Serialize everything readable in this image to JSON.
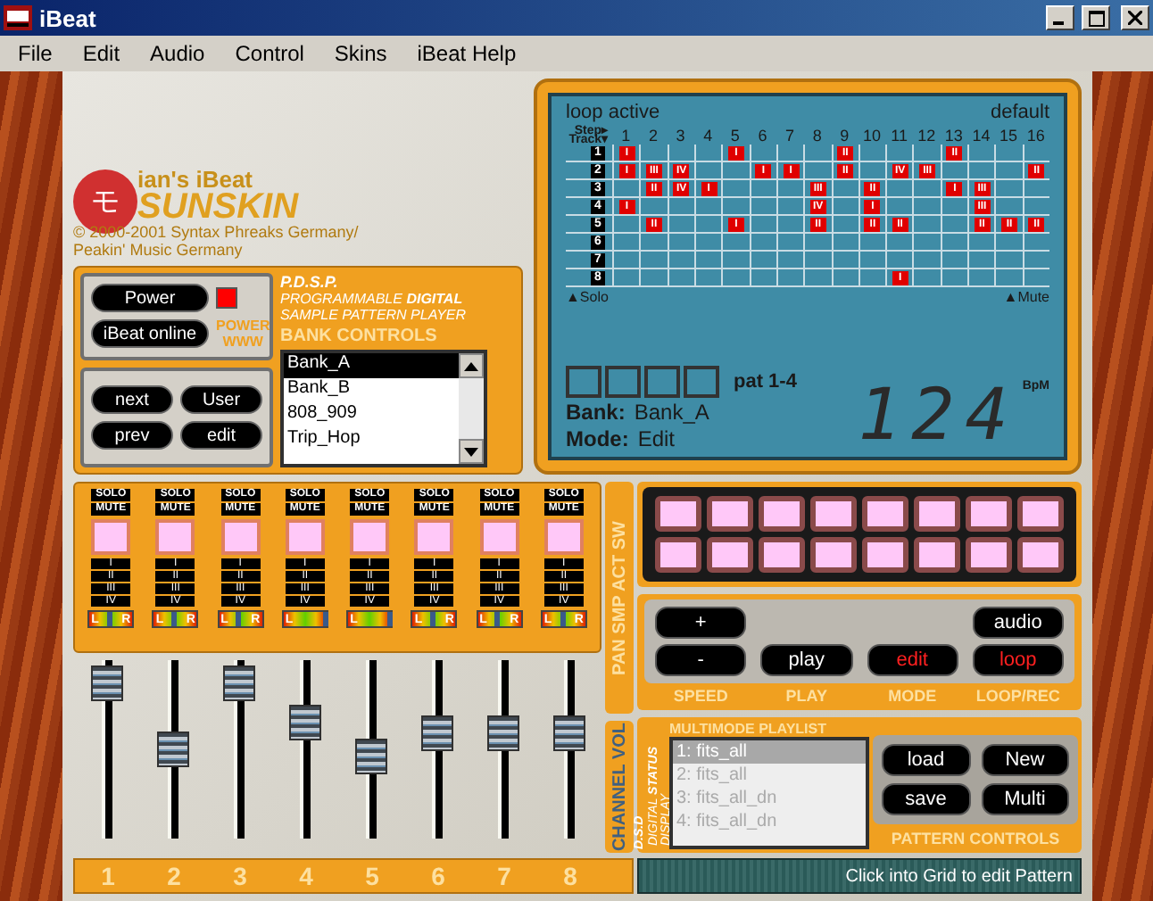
{
  "window": {
    "title": "iBeat"
  },
  "menu": [
    "File",
    "Edit",
    "Audio",
    "Control",
    "Skins",
    "iBeat Help"
  ],
  "logo": {
    "glyph": "モ",
    "line1": "ian's iBeat",
    "line2": "SUNSKIN",
    "copyright": "© 2000-2001 Syntax Phreaks Germany/ Peakin' Music Germany"
  },
  "power": {
    "buttons": [
      "Power",
      "iBeat online"
    ],
    "on": true,
    "labels": [
      "POWER",
      "WWW"
    ]
  },
  "navigation": [
    "next",
    "User",
    "prev",
    "edit"
  ],
  "product": {
    "name": "P.D.S.P.",
    "description": "PROGRAMMABLE **DIGITAL** SAMPLE PATTERN PLAYER",
    "section": "BANK CONTROLS"
  },
  "banks": [
    {
      "label": "Bank_A",
      "selected": true
    },
    {
      "label": "Bank_B",
      "selected": false
    },
    {
      "label": "808_909",
      "selected": false
    },
    {
      "label": "Trip_Hop",
      "selected": false
    }
  ],
  "display": {
    "status": "loop active",
    "preset": "default",
    "step_label": "Step▸",
    "track_label": "Track▾",
    "steps": [
      "1",
      "2",
      "3",
      "4",
      "5",
      "6",
      "7",
      "8",
      "9",
      "10",
      "11",
      "12",
      "13",
      "14",
      "15",
      "16"
    ],
    "tracks": [
      {
        "label": "1",
        "cells": [
          "I",
          null,
          null,
          null,
          "I",
          null,
          null,
          null,
          "II",
          null,
          null,
          null,
          "II",
          null,
          null,
          null
        ]
      },
      {
        "label": "2",
        "cells": [
          "I",
          "III",
          "IV",
          null,
          null,
          "I",
          "I",
          null,
          "II",
          null,
          "IV",
          "III",
          null,
          null,
          null,
          "II"
        ]
      },
      {
        "label": "3",
        "cells": [
          null,
          "II",
          "IV",
          "I",
          null,
          null,
          null,
          "III",
          null,
          "II",
          null,
          null,
          "I",
          "III",
          null,
          null
        ]
      },
      {
        "label": "4",
        "cells": [
          "I",
          null,
          null,
          null,
          null,
          null,
          null,
          "IV",
          null,
          "I",
          null,
          null,
          null,
          "III",
          null,
          null
        ]
      },
      {
        "label": "5",
        "cells": [
          null,
          "II",
          null,
          null,
          "I",
          null,
          null,
          "II",
          null,
          "II",
          "II",
          null,
          null,
          "II",
          "II",
          "II"
        ]
      },
      {
        "label": "6",
        "cells": [
          null,
          null,
          null,
          null,
          null,
          null,
          null,
          null,
          null,
          null,
          null,
          null,
          null,
          null,
          null,
          null
        ]
      },
      {
        "label": "7",
        "cells": [
          null,
          null,
          null,
          null,
          null,
          null,
          null,
          null,
          null,
          null,
          null,
          null,
          null,
          null,
          null,
          null
        ]
      },
      {
        "label": "8",
        "cells": [
          null,
          null,
          null,
          null,
          null,
          null,
          null,
          null,
          null,
          null,
          "I",
          null,
          null,
          null,
          null,
          null
        ]
      }
    ],
    "solo_label": "▲Solo",
    "mute_label": "▲Mute",
    "pattern": "pat 1-4",
    "bank_label": "Bank:",
    "bank": "Bank_A",
    "mode_label": "Mode:",
    "mode": "Edit",
    "bpm": "124",
    "bpm_unit": "BpM"
  },
  "channels": [
    {
      "number": "1",
      "solo": "SOLO",
      "mute": "MUTE",
      "samples": [
        "I",
        "II",
        "III",
        "IV"
      ],
      "pan": {
        "left": "L",
        "right": "R",
        "level": 0.45
      },
      "volume": {
        "level": 1
      }
    },
    {
      "number": "2",
      "solo": "SOLO",
      "mute": "MUTE",
      "samples": [
        "I",
        "II",
        "III",
        "IV"
      ],
      "pan": {
        "left": "L",
        "right": "R",
        "level": 0.45
      },
      "volume": {
        "level": 0.5
      }
    },
    {
      "number": "3",
      "solo": "SOLO",
      "mute": "MUTE",
      "samples": [
        "I",
        "II",
        "III",
        "IV"
      ],
      "pan": {
        "left": "L",
        "right": "R",
        "level": 0.45
      },
      "volume": {
        "level": 1
      }
    },
    {
      "number": "4",
      "solo": "SOLO",
      "mute": "MUTE",
      "samples": [
        "I",
        "II",
        "III",
        "IV"
      ],
      "pan": {
        "left": "L",
        "level": 0.95
      },
      "volume": {
        "level": 0.7
      }
    },
    {
      "number": "5",
      "solo": "SOLO",
      "mute": "MUTE",
      "samples": [
        "I",
        "II",
        "III",
        "IV"
      ],
      "pan": {
        "left": "L",
        "level": 0.95
      },
      "volume": {
        "level": 0.45
      }
    },
    {
      "number": "6",
      "solo": "SOLO",
      "mute": "MUTE",
      "samples": [
        "I",
        "II",
        "III",
        "IV"
      ],
      "pan": {
        "left": "L",
        "right": "R",
        "level": 0.45
      },
      "volume": {
        "level": 0.62
      }
    },
    {
      "number": "7",
      "solo": "SOLO",
      "mute": "MUTE",
      "samples": [
        "I",
        "II",
        "III",
        "IV"
      ],
      "pan": {
        "left": "L",
        "right": "R",
        "level": 0.45
      },
      "volume": {
        "level": 0.62
      }
    },
    {
      "number": "8",
      "solo": "SOLO",
      "mute": "MUTE",
      "samples": [
        "I",
        "II",
        "III",
        "IV"
      ],
      "pan": {
        "left": "L",
        "right": "R",
        "level": 0.45
      },
      "volume": {
        "level": 0.62
      }
    }
  ],
  "side_labels": {
    "pan": "PAN SMP ACT SW",
    "volume": "CHANNEL VOL"
  },
  "transport": {
    "buttons": [
      {
        "label": "+",
        "active": false
      },
      {
        "label": "audio",
        "active": false
      },
      {
        "label": "-",
        "active": false
      },
      {
        "label": "play",
        "active": false
      },
      {
        "label": "edit",
        "active": true
      },
      {
        "label": "loop",
        "active": true
      }
    ],
    "captions": [
      "SPEED",
      "PLAY",
      "MODE",
      "LOOP/REC"
    ]
  },
  "playlist": {
    "title": "MULTIMODE PLAYLIST",
    "abbr": "D.S.D",
    "caption": "DIGITAL **STATUS** DISPLAY",
    "items": [
      {
        "label": "1: fits_all",
        "selected": true
      },
      {
        "label": "2: fits_all",
        "selected": false
      },
      {
        "label": "3: fits_all_dn",
        "selected": false
      },
      {
        "label": "4: fits_all_dn",
        "selected": false
      }
    ]
  },
  "pattern_controls": {
    "buttons": [
      "load",
      "New",
      "save",
      "Multi"
    ],
    "title": "PATTERN CONTROLS"
  },
  "status_bar": "Click into Grid to edit Pattern"
}
